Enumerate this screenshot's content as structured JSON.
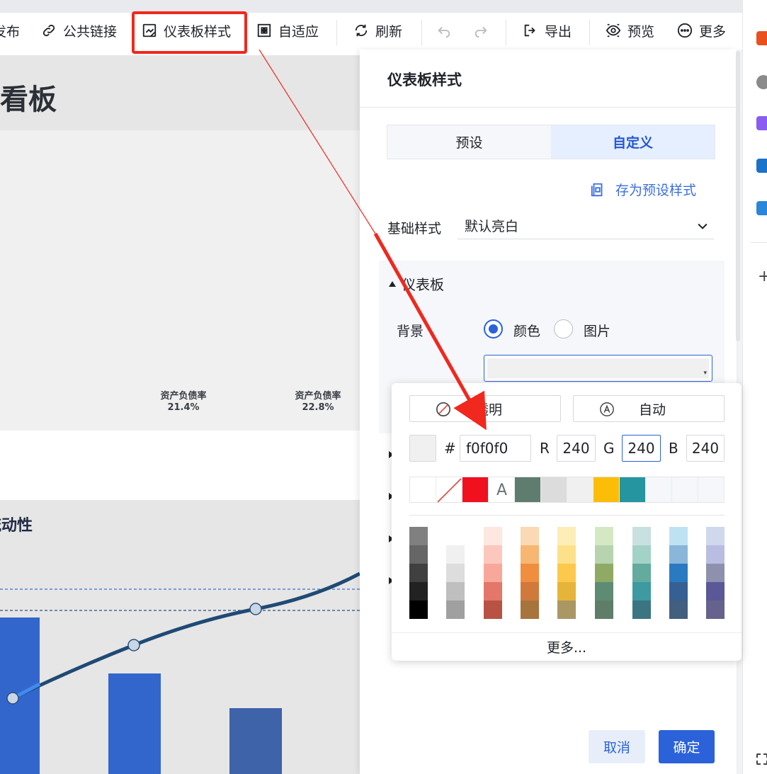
{
  "toolbar": {
    "publish_label": "发布",
    "public_link_label": "公共链接",
    "dashboard_style_label": "仪表板样式",
    "adaptive_label": "自适应",
    "refresh_label": "刷新",
    "export_label": "导出",
    "preview_label": "预览",
    "more_label": "更多"
  },
  "dashboard": {
    "title": "新看板",
    "kpis": [
      {
        "label": "资产负债率",
        "value": "21.4%"
      },
      {
        "label": "资产负债率",
        "value": "22.8%"
      }
    ],
    "chart_title": "流动性"
  },
  "chart_data": {
    "type": "bar",
    "note_series": [
      {
        "kind": "bar",
        "values": [
          0.8,
          0.55,
          0.35
        ]
      },
      {
        "kind": "line",
        "values": [
          0.35,
          0.6,
          0.77,
          0.9
        ]
      }
    ],
    "colors": [
      "#3366cc",
      "#2e5ca8",
      "#3e63a8",
      "#1e4a78"
    ]
  },
  "panel": {
    "title": "仪表板样式",
    "tabs": [
      {
        "label": "预设",
        "active": false
      },
      {
        "label": "自定义",
        "active": true
      }
    ],
    "save_preset_label": "存为预设样式",
    "base_style_label": "基础样式",
    "base_style_value": "默认亮白",
    "section_label": "仪表板",
    "background_label": "背景",
    "bg_options": [
      {
        "label": "颜色",
        "selected": true
      },
      {
        "label": "图片",
        "selected": false
      }
    ],
    "bg_color": "#f0f0f0",
    "cancel_label": "取消",
    "ok_label": "确定"
  },
  "picker": {
    "transparent_label": "透明",
    "auto_label": "自动",
    "hash_label": "#",
    "hex_value": "f0f0f0",
    "r_label": "R",
    "r_value": "240",
    "g_label": "G",
    "g_value": "240",
    "b_label": "B",
    "b_value": "240",
    "recent_colors": [
      "#ffffff",
      "none",
      "#f0101e",
      "text-A",
      "#5f7d6e",
      "#dcdcdc",
      "#f0f0f0",
      "#fbbd08",
      "#2595a0",
      "#f5f7fa",
      "#f5f7fa",
      "#f5f7fa"
    ],
    "palette": [
      [
        "#808080",
        "#666666",
        "#404040",
        "#222222",
        "#000000"
      ],
      [
        "#ffffff",
        "#f0f0f0",
        "#dddddd",
        "#bfbfbf",
        "#a0a0a0"
      ],
      [
        "#fde7e1",
        "#fcc8bd",
        "#f8a89a",
        "#e2776a",
        "#b85245"
      ],
      [
        "#fbd9b5",
        "#f8b673",
        "#ee8e3e",
        "#d0793a",
        "#a7743d"
      ],
      [
        "#fdeeb8",
        "#fde08a",
        "#fdc94d",
        "#e6b43a",
        "#ab9764"
      ],
      [
        "#d5e8c4",
        "#b7d3af",
        "#8eaa65",
        "#5e8b73",
        "#5e7e6a"
      ],
      [
        "#c8e1e0",
        "#a3d2c7",
        "#62ab9e",
        "#3c9aa0",
        "#3c7582"
      ],
      [
        "#bfe2f3",
        "#8ab6d9",
        "#2a7ac2",
        "#365f93",
        "#435f7f"
      ],
      [
        "#cfd8ec",
        "#b9bde2",
        "#8f90ae",
        "#5a5897",
        "#66628e"
      ]
    ],
    "more_label": "更多..."
  }
}
